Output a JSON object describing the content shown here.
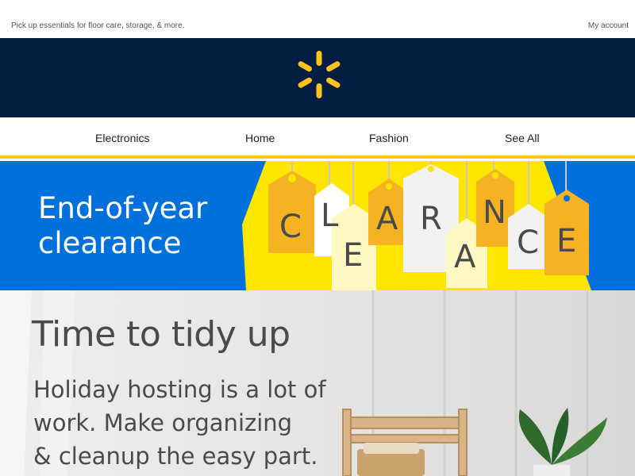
{
  "preheader": {
    "tagline": "Pick up essentials for floor care, storage, & more.",
    "account_link": "My account"
  },
  "brand": {
    "logo_icon": "walmart-spark-icon",
    "logo_color": "#ffc220",
    "bar_color": "#041e42"
  },
  "nav": {
    "items": [
      {
        "label": "Electronics"
      },
      {
        "label": "Home"
      },
      {
        "label": "Fashion"
      },
      {
        "label": "See All"
      }
    ],
    "underline_color": "#ffc220"
  },
  "clearance_banner": {
    "headline_line1": "End-of-year",
    "headline_line2": "clearance",
    "tag_letters": [
      "C",
      "L",
      "E",
      "A",
      "R",
      "A",
      "N",
      "C",
      "E"
    ],
    "background_color": "#0071dc",
    "accent_color": "#ffe600"
  },
  "tidy_banner": {
    "title": "Time to tidy up",
    "copy_line1": "Holiday hosting is a lot of",
    "copy_line2": "work. Make organizing",
    "copy_line3": "& cleanup the easy part."
  }
}
